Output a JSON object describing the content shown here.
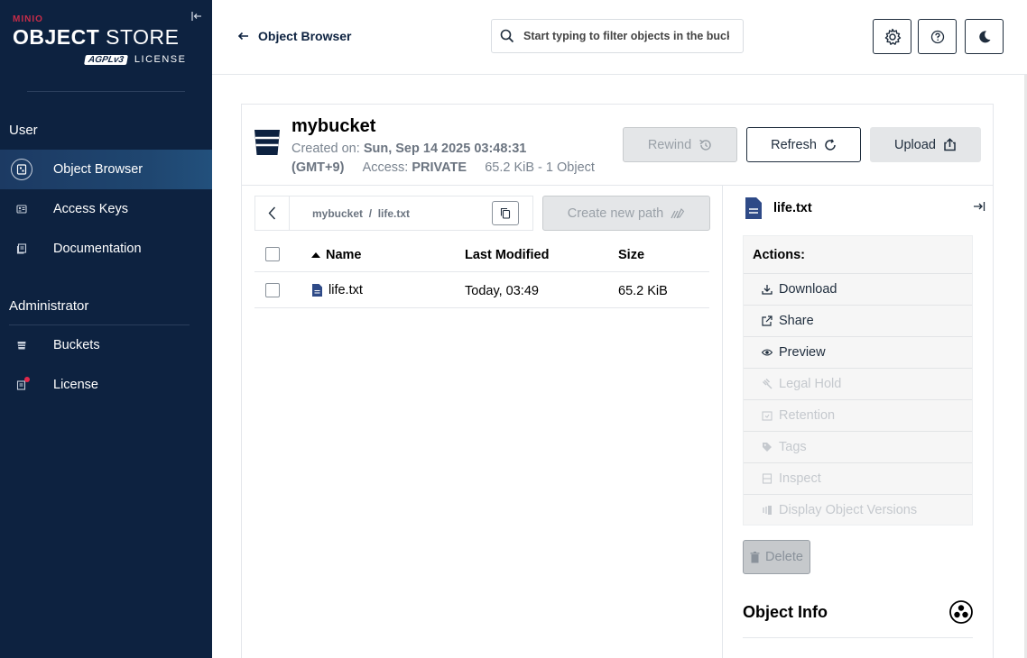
{
  "brand": {
    "small": "MINIO",
    "title_bold": "OBJECT",
    "title_rest": " STORE",
    "agpl": "AGPLv3",
    "license": "LICENSE"
  },
  "sidebar": {
    "user_section": "User",
    "admin_section": "Administrator",
    "user_items": [
      {
        "label": "Object Browser",
        "icon": "object-browser-icon",
        "active": true
      },
      {
        "label": "Access Keys",
        "icon": "access-keys-icon"
      },
      {
        "label": "Documentation",
        "icon": "documentation-icon"
      }
    ],
    "admin_items": [
      {
        "label": "Buckets",
        "icon": "buckets-icon"
      },
      {
        "label": "License",
        "icon": "license-icon",
        "badge": true
      }
    ]
  },
  "header": {
    "back_label": "Object Browser",
    "search_placeholder": "Start typing to filter objects in the bucket"
  },
  "bucket": {
    "name": "mybucket",
    "created_label": "Created on: ",
    "created_value": "Sun, Sep 14 2025 03:48:31",
    "timezone": "(GMT+9)",
    "access_label": "Access: ",
    "access_value": "PRIVATE",
    "summary": "65.2 KiB - 1 Object"
  },
  "actions": {
    "rewind": "Rewind",
    "refresh": "Refresh",
    "upload": "Upload"
  },
  "breadcrumb": {
    "bucket": "mybucket",
    "separator": "/",
    "file": "life.txt"
  },
  "create_path_label": "Create new path",
  "table": {
    "headers": {
      "name": "Name",
      "modified": "Last Modified",
      "size": "Size"
    },
    "rows": [
      {
        "name": "life.txt",
        "modified": "Today, 03:49",
        "size": "65.2 KiB"
      }
    ]
  },
  "panel": {
    "object_name": "life.txt",
    "actions_title": "Actions:",
    "items": [
      {
        "label": "Download",
        "enabled": true
      },
      {
        "label": "Share",
        "enabled": true
      },
      {
        "label": "Preview",
        "enabled": true
      },
      {
        "label": "Legal Hold",
        "enabled": false
      },
      {
        "label": "Retention",
        "enabled": false
      },
      {
        "label": "Tags",
        "enabled": false
      },
      {
        "label": "Inspect",
        "enabled": false
      },
      {
        "label": "Display Object Versions",
        "enabled": false
      }
    ],
    "delete_label": "Delete",
    "object_info_title": "Object Info"
  },
  "colors": {
    "sidebar_bg": "#0d2240",
    "brand_red": "#c72c48",
    "badge_red": "#e0284b",
    "text_dark": "#1f2d3d"
  }
}
